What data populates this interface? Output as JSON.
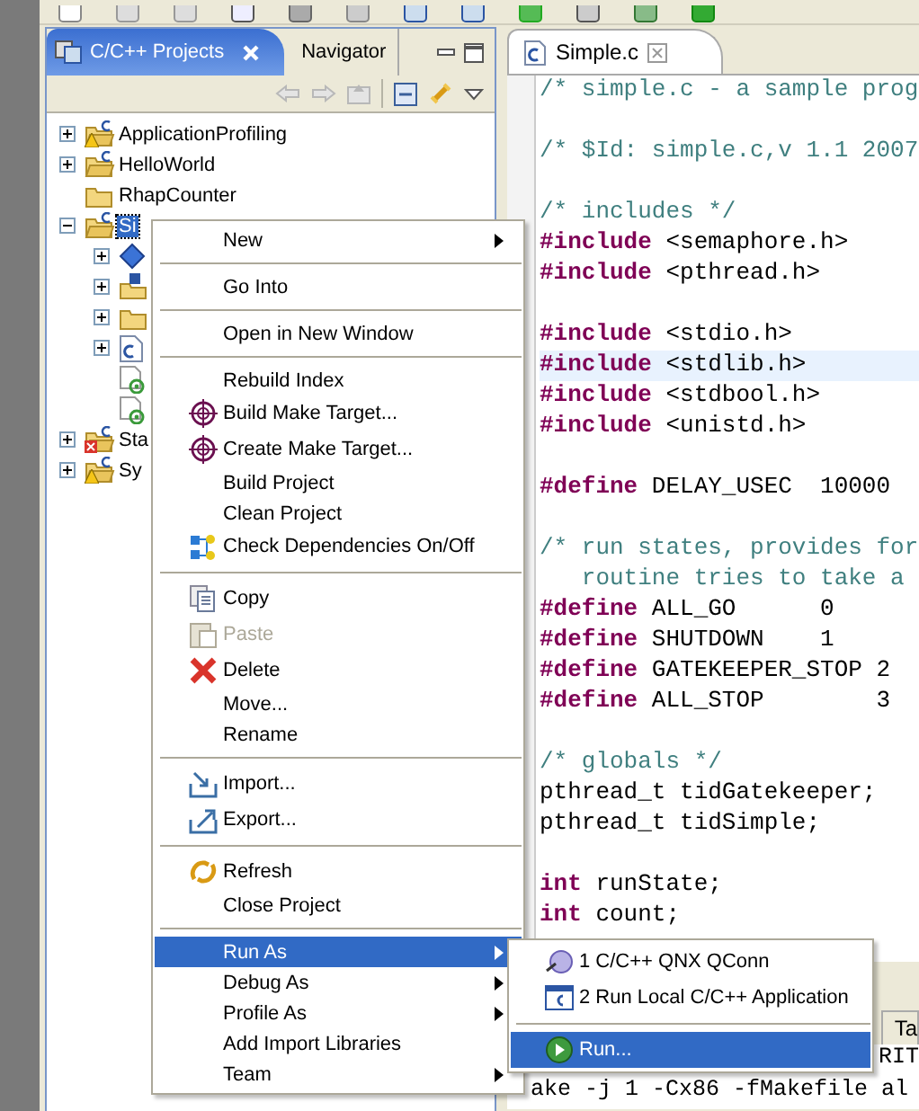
{
  "projects_view": {
    "tabs": [
      {
        "label": "C/C++ Projects",
        "selected": true
      },
      {
        "label": "Navigator",
        "selected": false
      }
    ],
    "tree": [
      {
        "label": "ApplicationProfiling",
        "kind": "node",
        "expanded": false,
        "selected": false
      },
      {
        "label": "HelloWorld",
        "kind": "node",
        "expanded": false,
        "selected": false
      },
      {
        "label": "RhapCounter",
        "kind": "leaf",
        "selected": false
      },
      {
        "label": "Si",
        "kind": "node",
        "expanded": true,
        "selected": true,
        "children": [
          {
            "kind": "node",
            "expanded": false
          },
          {
            "kind": "node",
            "expanded": false
          },
          {
            "kind": "node",
            "expanded": false
          },
          {
            "kind": "node",
            "expanded": false
          },
          {
            "kind": "leaf"
          },
          {
            "kind": "leaf"
          }
        ]
      },
      {
        "label": "Sta",
        "kind": "node",
        "expanded": false,
        "selected": false
      },
      {
        "label": "Sy",
        "kind": "node",
        "expanded": false,
        "selected": false
      }
    ]
  },
  "editor": {
    "tab": {
      "label": "Simple.c",
      "selected": true
    },
    "lines": [
      {
        "current": false,
        "segments": [
          {
            "kind": "comment",
            "text": "/* simple.c - a sample prog"
          }
        ]
      },
      {
        "current": false
      },
      {
        "current": false,
        "segments": [
          {
            "kind": "comment",
            "text": "/* $Id: simple.c,v 1.1 2007"
          }
        ]
      },
      {
        "current": false
      },
      {
        "current": false,
        "segments": [
          {
            "kind": "comment",
            "text": "/* includes */"
          }
        ]
      },
      {
        "current": false,
        "segments": [
          {
            "kind": "keyword",
            "text": "#include"
          },
          {
            "kind": "plain",
            "text": " <semaphore.h>"
          }
        ]
      },
      {
        "current": false,
        "segments": [
          {
            "kind": "keyword",
            "text": "#include"
          },
          {
            "kind": "plain",
            "text": " <pthread.h>"
          }
        ]
      },
      {
        "current": false
      },
      {
        "current": false,
        "segments": [
          {
            "kind": "keyword",
            "text": "#include"
          },
          {
            "kind": "plain",
            "text": " <stdio.h>"
          }
        ]
      },
      {
        "current": true,
        "segments": [
          {
            "kind": "keyword",
            "text": "#include"
          },
          {
            "kind": "plain",
            "text": " <stdlib.h>"
          }
        ]
      },
      {
        "current": false,
        "segments": [
          {
            "kind": "keyword",
            "text": "#include"
          },
          {
            "kind": "plain",
            "text": " <stdbool.h>"
          }
        ]
      },
      {
        "current": false,
        "segments": [
          {
            "kind": "keyword",
            "text": "#include"
          },
          {
            "kind": "plain",
            "text": " <unistd.h>"
          }
        ]
      },
      {
        "current": false
      },
      {
        "current": false,
        "segments": [
          {
            "kind": "keyword",
            "text": "#define"
          },
          {
            "kind": "plain",
            "text": " DELAY_USEC  10000"
          }
        ]
      },
      {
        "current": false
      },
      {
        "current": false,
        "segments": [
          {
            "kind": "comment",
            "text": "/* run states, provides for"
          }
        ]
      },
      {
        "current": false,
        "segments": [
          {
            "kind": "comment",
            "text": "   routine tries to take a"
          }
        ]
      },
      {
        "current": false,
        "segments": [
          {
            "kind": "keyword",
            "text": "#define"
          },
          {
            "kind": "plain",
            "text": " ALL_GO      0"
          }
        ]
      },
      {
        "current": false,
        "segments": [
          {
            "kind": "keyword",
            "text": "#define"
          },
          {
            "kind": "plain",
            "text": " SHUTDOWN    1"
          }
        ]
      },
      {
        "current": false,
        "segments": [
          {
            "kind": "keyword",
            "text": "#define"
          },
          {
            "kind": "plain",
            "text": " GATEKEEPER_STOP 2"
          }
        ]
      },
      {
        "current": false,
        "segments": [
          {
            "kind": "keyword",
            "text": "#define"
          },
          {
            "kind": "plain",
            "text": " ALL_STOP        3"
          }
        ]
      },
      {
        "current": false
      },
      {
        "current": false,
        "segments": [
          {
            "kind": "comment",
            "text": "/* globals */"
          }
        ]
      },
      {
        "current": false,
        "segments": [
          {
            "kind": "plain",
            "text": "pthread_t tidGatekeeper;"
          }
        ]
      },
      {
        "current": false,
        "segments": [
          {
            "kind": "plain",
            "text": "pthread_t tidSimple;"
          }
        ]
      },
      {
        "current": false
      },
      {
        "current": false,
        "segments": [
          {
            "kind": "keyword",
            "text": "int"
          },
          {
            "kind": "plain",
            "text": " runState;"
          }
        ]
      },
      {
        "current": false,
        "segments": [
          {
            "kind": "keyword",
            "text": "int"
          },
          {
            "kind": "plain",
            "text": " count;"
          }
        ]
      },
      {
        "current": false
      }
    ]
  },
  "console": {
    "tab": {
      "label": "Ta"
    },
    "lines": [
      "RIT",
      "ake -j 1 -Cx86 -fMakefile al"
    ]
  },
  "context_menu": [
    {
      "kind": "item",
      "label": "New",
      "submenu": true,
      "selected": false,
      "disabled": false
    },
    {
      "kind": "separator"
    },
    {
      "kind": "item",
      "label": "Go Into",
      "submenu": false,
      "selected": false,
      "disabled": false
    },
    {
      "kind": "separator"
    },
    {
      "kind": "item",
      "label": "Open in New Window",
      "submenu": false,
      "selected": false,
      "disabled": false
    },
    {
      "kind": "separator"
    },
    {
      "kind": "item",
      "label": "Rebuild Index",
      "submenu": false,
      "selected": false,
      "disabled": false
    },
    {
      "kind": "item",
      "label": "Build Make Target...",
      "submenu": false,
      "selected": false,
      "disabled": false
    },
    {
      "kind": "item",
      "label": "Create Make Target...",
      "submenu": false,
      "selected": false,
      "disabled": false
    },
    {
      "kind": "item",
      "label": "Build Project",
      "submenu": false,
      "selected": false,
      "disabled": false
    },
    {
      "kind": "item",
      "label": "Clean Project",
      "submenu": false,
      "selected": false,
      "disabled": false
    },
    {
      "kind": "item",
      "label": "Check Dependencies On/Off",
      "submenu": false,
      "selected": false,
      "disabled": false
    },
    {
      "kind": "separator"
    },
    {
      "kind": "item",
      "label": "Copy",
      "submenu": false,
      "selected": false,
      "disabled": false
    },
    {
      "kind": "item",
      "label": "Paste",
      "submenu": false,
      "selected": false,
      "disabled": true
    },
    {
      "kind": "item",
      "label": "Delete",
      "submenu": false,
      "selected": false,
      "disabled": false
    },
    {
      "kind": "item",
      "label": "Move...",
      "submenu": false,
      "selected": false,
      "disabled": false
    },
    {
      "kind": "item",
      "label": "Rename",
      "submenu": false,
      "selected": false,
      "disabled": false
    },
    {
      "kind": "separator"
    },
    {
      "kind": "item",
      "label": "Import...",
      "submenu": false,
      "selected": false,
      "disabled": false
    },
    {
      "kind": "item",
      "label": "Export...",
      "submenu": false,
      "selected": false,
      "disabled": false
    },
    {
      "kind": "separator"
    },
    {
      "kind": "item",
      "label": "Refresh",
      "submenu": false,
      "selected": false,
      "disabled": false
    },
    {
      "kind": "item",
      "label": "Close Project",
      "submenu": false,
      "selected": false,
      "disabled": false
    },
    {
      "kind": "separator"
    },
    {
      "kind": "item",
      "label": "Run As",
      "submenu": true,
      "selected": true,
      "disabled": false
    },
    {
      "kind": "item",
      "label": "Debug As",
      "submenu": true,
      "selected": false,
      "disabled": false
    },
    {
      "kind": "item",
      "label": "Profile As",
      "submenu": true,
      "selected": false,
      "disabled": false
    },
    {
      "kind": "item",
      "label": "Add Import Libraries",
      "submenu": false,
      "selected": false,
      "disabled": false
    },
    {
      "kind": "item",
      "label": "Team",
      "submenu": true,
      "selected": false,
      "disabled": false
    }
  ],
  "run_as_submenu": [
    {
      "kind": "item",
      "label": "1 C/C++ QNX QConn",
      "submenu": false,
      "selected": false,
      "disabled": false
    },
    {
      "kind": "item",
      "label": "2 Run Local C/C++ Application",
      "submenu": false,
      "selected": false,
      "disabled": false
    },
    {
      "kind": "separator"
    },
    {
      "kind": "item",
      "label": "Run...",
      "submenu": false,
      "selected": true,
      "disabled": false
    }
  ]
}
